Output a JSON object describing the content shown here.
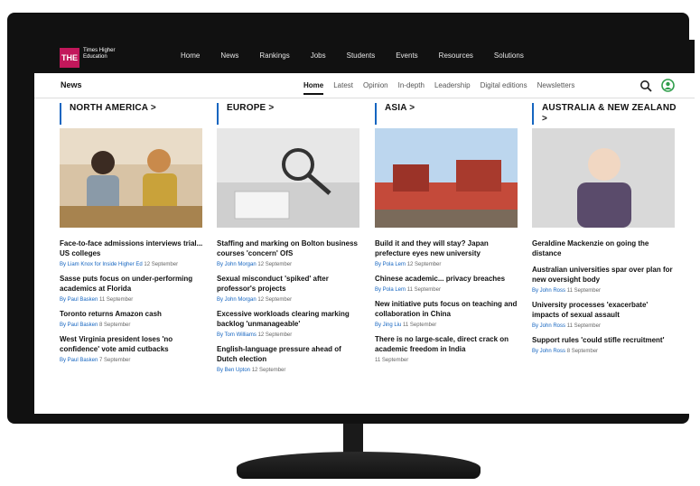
{
  "nav": {
    "logo_mark": "THE",
    "logo_text": "Times Higher Education",
    "items": [
      "Home",
      "News",
      "Rankings",
      "Jobs",
      "Students",
      "Events",
      "Resources",
      "Solutions"
    ]
  },
  "subnav": {
    "title": "News",
    "items": [
      "Home",
      "Latest",
      "Opinion",
      "In-depth",
      "Leadership",
      "Digital editions",
      "Newsletters"
    ]
  },
  "columns": [
    {
      "heading": "NORTH AMERICA >",
      "articles": [
        {
          "title": "Face-to-face admissions interviews trial... US colleges",
          "author": "By Liam Knox for Inside Higher Ed",
          "date": "12 September"
        },
        {
          "title": "Sasse puts focus on under-performing academics at Florida",
          "author": "By Paul Basken",
          "date": "11 September"
        },
        {
          "title": "Toronto returns Amazon cash",
          "author": "By Paul Basken",
          "date": "8 September"
        },
        {
          "title": "West Virginia president loses 'no confidence' vote amid cutbacks",
          "author": "By Paul Basken",
          "date": "7 September"
        }
      ]
    },
    {
      "heading": "EUROPE >",
      "articles": [
        {
          "title": "Staffing and marking on Bolton business courses 'concern' OfS",
          "author": "By John Morgan",
          "date": "12 September"
        },
        {
          "title": "Sexual misconduct 'spiked' after professor's projects",
          "author": "By John Morgan",
          "date": "12 September"
        },
        {
          "title": "Excessive workloads clearing marking backlog 'unmanageable'",
          "author": "By Tom Williams",
          "date": "12 September"
        },
        {
          "title": "English-language pressure ahead of Dutch election",
          "author": "By Ben Upton",
          "date": "12 September"
        }
      ]
    },
    {
      "heading": "ASIA >",
      "articles": [
        {
          "title": "Build it and they will stay? Japan prefecture eyes new university",
          "author": "By Pola Lem",
          "date": "12 September"
        },
        {
          "title": "Chinese academic... privacy breaches",
          "author": "By Pola Lem",
          "date": "11 September"
        },
        {
          "title": "New initiative puts focus on teaching and collaboration in China",
          "author": "By Jing Liu",
          "date": "11 September"
        },
        {
          "title": "There is no large-scale, direct crack on academic freedom in India",
          "author": "",
          "date": "11 September"
        }
      ]
    },
    {
      "heading": "AUSTRALIA & NEW ZEALAND >",
      "articles": [
        {
          "title": "Geraldine Mackenzie on going the distance",
          "author": "",
          "date": ""
        },
        {
          "title": "Australian universities spar over plan for new oversight body",
          "author": "By John Ross",
          "date": "11 September"
        },
        {
          "title": "University processes 'exacerbate' impacts of sexual assault",
          "author": "By John Ross",
          "date": "11 September"
        },
        {
          "title": "Support rules 'could stifle recruitment'",
          "author": "By John Ross",
          "date": "8 September"
        }
      ]
    }
  ],
  "colors": {
    "accent": "#1565c0",
    "logo": "#c2185b",
    "topbar": "#111111",
    "user": "#2e9d4a"
  }
}
